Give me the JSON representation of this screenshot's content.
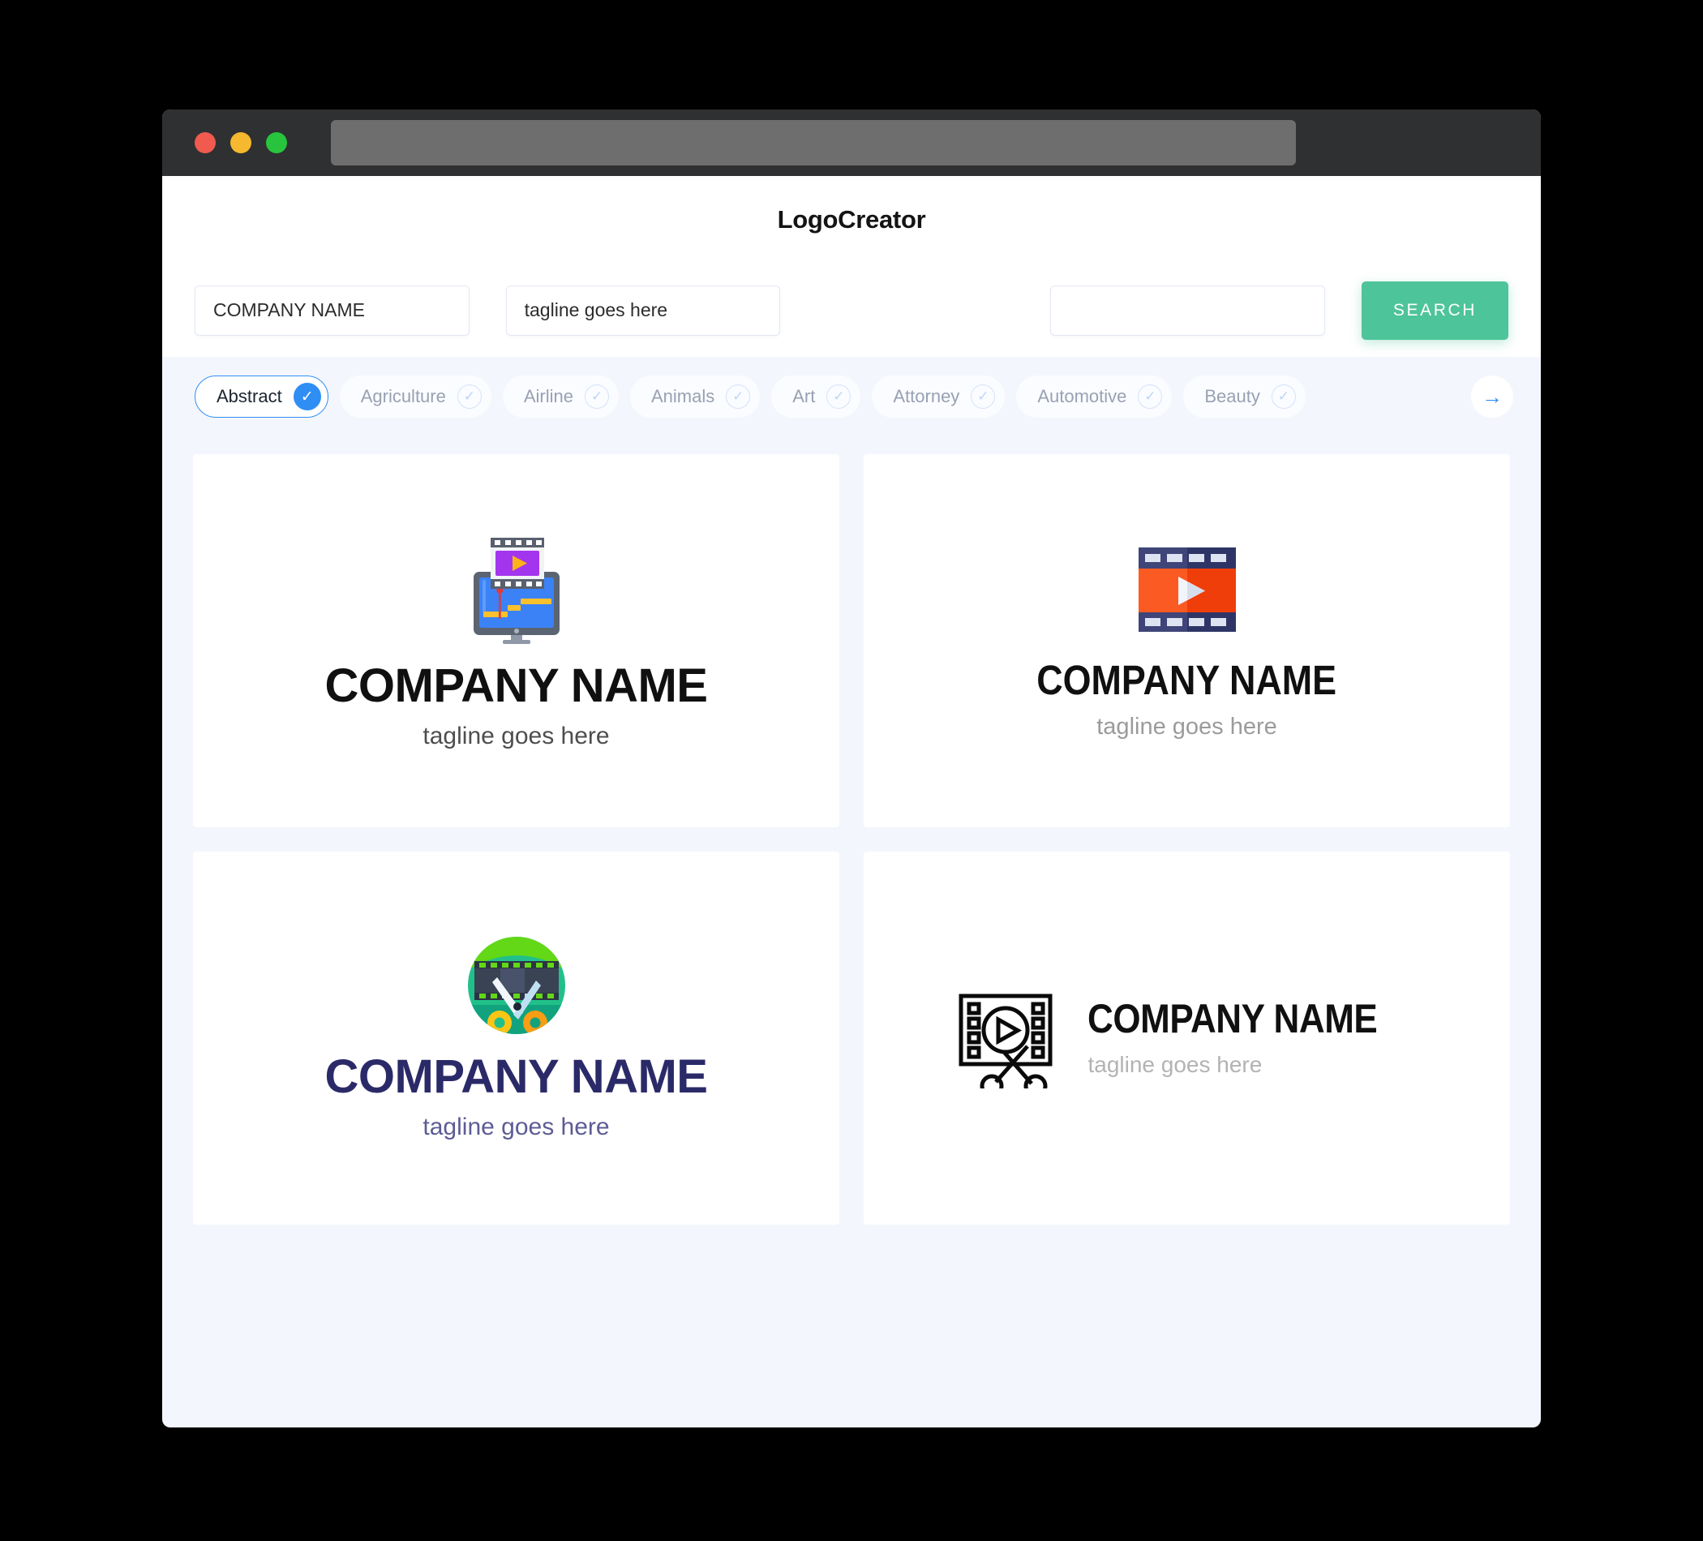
{
  "window": {
    "traffic_lights": [
      {
        "name": "close",
        "color": "#f05a4f"
      },
      {
        "name": "minimize",
        "color": "#f5b82e"
      },
      {
        "name": "maximize",
        "color": "#28c43e"
      }
    ],
    "url_bar_value": ""
  },
  "header": {
    "app_title": "LogoCreator"
  },
  "search": {
    "company_name_value": "COMPANY NAME",
    "company_name_placeholder": "COMPANY NAME",
    "tagline_value": "tagline goes here",
    "tagline_placeholder": "tagline goes here",
    "keyword_value": "",
    "keyword_placeholder": "",
    "search_button_label": "SEARCH"
  },
  "categories": {
    "next_arrow_icon": "arrow-right-icon",
    "items": [
      {
        "label": "Abstract",
        "selected": true,
        "check_icon": "check-icon"
      },
      {
        "label": "Agriculture",
        "selected": false,
        "check_icon": "check-icon"
      },
      {
        "label": "Airline",
        "selected": false,
        "check_icon": "check-icon"
      },
      {
        "label": "Animals",
        "selected": false,
        "check_icon": "check-icon"
      },
      {
        "label": "Art",
        "selected": false,
        "check_icon": "check-icon"
      },
      {
        "label": "Attorney",
        "selected": false,
        "check_icon": "check-icon"
      },
      {
        "label": "Automotive",
        "selected": false,
        "check_icon": "check-icon"
      },
      {
        "label": "Beauty",
        "selected": false,
        "check_icon": "check-icon"
      }
    ]
  },
  "results": {
    "cards": [
      {
        "icon_name": "monitor-video-editing-icon",
        "company_name": "COMPANY NAME",
        "tagline": "tagline goes here",
        "layout": "vertical",
        "name_color": "#101010",
        "tagline_color": "#4e4e4e"
      },
      {
        "icon_name": "film-strip-play-icon",
        "company_name": "COMPANY NAME",
        "tagline": "tagline goes here",
        "layout": "vertical",
        "name_color": "#101010",
        "tagline_color": "#9b9b9b"
      },
      {
        "icon_name": "green-circle-film-scissors-icon",
        "company_name": "COMPANY NAME",
        "tagline": "tagline goes here",
        "layout": "vertical",
        "name_color": "#2b2a68",
        "tagline_color": "#5d5c95"
      },
      {
        "icon_name": "outline-film-play-scissors-icon",
        "company_name": "COMPANY NAME",
        "tagline": "tagline goes here",
        "layout": "horizontal",
        "name_color": "#101010",
        "tagline_color": "#b3b3b3"
      }
    ]
  },
  "colors": {
    "accent_green": "#4ec49a",
    "accent_blue": "#2f8ef4",
    "page_background": "#f4f6fd",
    "titlebar": "#2f3032"
  }
}
